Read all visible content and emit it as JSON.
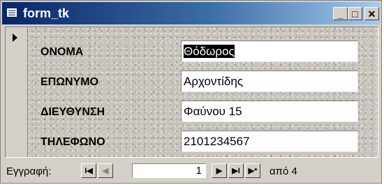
{
  "window": {
    "title": "form_tk",
    "icon": "form-icon",
    "minimize_glyph": "_",
    "maximize_glyph": "□",
    "close_glyph": "✕"
  },
  "fields": [
    {
      "label": "ΟΝΟΜΑ",
      "value": "Θόδωρος"
    },
    {
      "label": "ΕΠΩΝΥΜΟ",
      "value": "Αρχοντίδης"
    },
    {
      "label": "ΔΙΕΥΘΥΝΣΗ",
      "value": "Φαύνου 15"
    },
    {
      "label": "ΤΗΛΕΦΩΝΟ",
      "value": "2101234567"
    }
  ],
  "navigation": {
    "label": "Εγγραφή:",
    "first_glyph": "I◀",
    "prev_glyph": "◀",
    "current_record": "1",
    "next_glyph": "▶",
    "last_glyph": "▶I",
    "new_glyph": "▶*",
    "of_text": "από 4"
  }
}
